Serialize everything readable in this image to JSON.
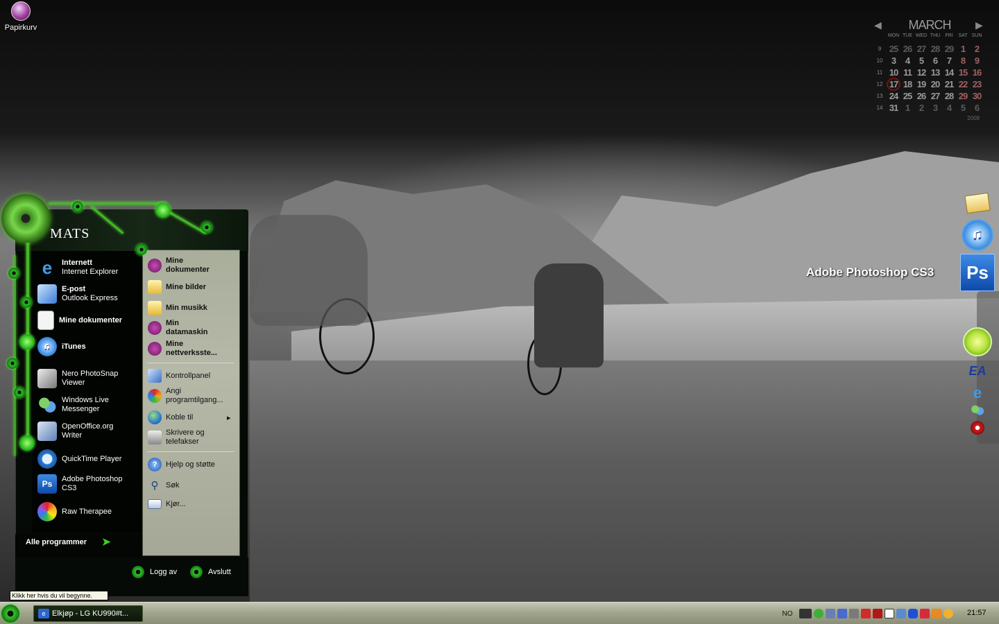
{
  "desktop": {
    "icons": [
      {
        "label": "Papirkurv",
        "icon": "recycle-bin-icon"
      }
    ],
    "dock_tooltip": "Adobe Photoshop CS3",
    "dock_items": [
      "mail-icon",
      "itunes-icon",
      "photoshop-icon",
      "limewire-icon",
      "ea-icon",
      "internet-explorer-icon",
      "messenger-icon",
      "media-icon"
    ]
  },
  "calendar": {
    "month": "MARCH",
    "year": "2008",
    "weekdays": [
      "MON",
      "TUE",
      "WED",
      "THU",
      "FRI",
      "SAT",
      "SUN"
    ],
    "weeks": [
      {
        "wk": "9",
        "days": [
          "25",
          "26",
          "27",
          "28",
          "29",
          "1",
          "2"
        ]
      },
      {
        "wk": "10",
        "days": [
          "3",
          "4",
          "5",
          "6",
          "7",
          "8",
          "9"
        ]
      },
      {
        "wk": "11",
        "days": [
          "10",
          "11",
          "12",
          "13",
          "14",
          "15",
          "16"
        ]
      },
      {
        "wk": "12",
        "days": [
          "17",
          "18",
          "19",
          "20",
          "21",
          "22",
          "23"
        ]
      },
      {
        "wk": "13",
        "days": [
          "24",
          "25",
          "26",
          "27",
          "28",
          "29",
          "30"
        ]
      },
      {
        "wk": "14",
        "days": [
          "31",
          "1",
          "2",
          "3",
          "4",
          "5",
          "6"
        ]
      }
    ],
    "today": "17"
  },
  "start_menu": {
    "user": "MATS",
    "pinned": [
      {
        "title": "Internett",
        "subtitle": "Internet Explorer"
      },
      {
        "title": "E-post",
        "subtitle": "Outlook Express"
      },
      {
        "title": "Mine dokumenter",
        "subtitle": ""
      }
    ],
    "recent": [
      {
        "title": "iTunes",
        "line2": ""
      },
      {
        "title": "Nero PhotoSnap",
        "line2": "Viewer"
      },
      {
        "title": "Windows Live",
        "line2": "Messenger"
      },
      {
        "title": "OpenOffice.org",
        "line2": "Writer"
      },
      {
        "title": "QuickTime Player",
        "line2": ""
      },
      {
        "title": "Adobe Photoshop",
        "line2": "CS3"
      },
      {
        "title": "Raw Therapee",
        "line2": ""
      }
    ],
    "all_programs": "Alle programmer",
    "places": [
      {
        "label": "Mine",
        "line2": "dokumenter"
      },
      {
        "label": "Mine bilder",
        "line2": ""
      },
      {
        "label": "Min musikk",
        "line2": ""
      },
      {
        "label": "Min",
        "line2": "datamaskin"
      },
      {
        "label": "Mine",
        "line2": "nettverksste..."
      }
    ],
    "system": [
      {
        "label": "Kontrollpanel",
        "line2": ""
      },
      {
        "label": "Angi",
        "line2": "programtilgang..."
      },
      {
        "label": "Koble til",
        "line2": "",
        "submenu_arrow": "▸"
      },
      {
        "label": "Skrivere og",
        "line2": "telefakser"
      }
    ],
    "help": [
      {
        "label": "Hjelp og støtte"
      },
      {
        "label": "Søk"
      },
      {
        "label": "Kjør..."
      }
    ],
    "logoff": "Logg av",
    "shutdown": "Avslutt"
  },
  "tooltip": "Klikk her hvis du vil begynne.",
  "taskbar": {
    "tasks": [
      {
        "label": "Elkjøp - LG KU990#t..."
      }
    ],
    "language": "NO",
    "clock": "21:57"
  }
}
